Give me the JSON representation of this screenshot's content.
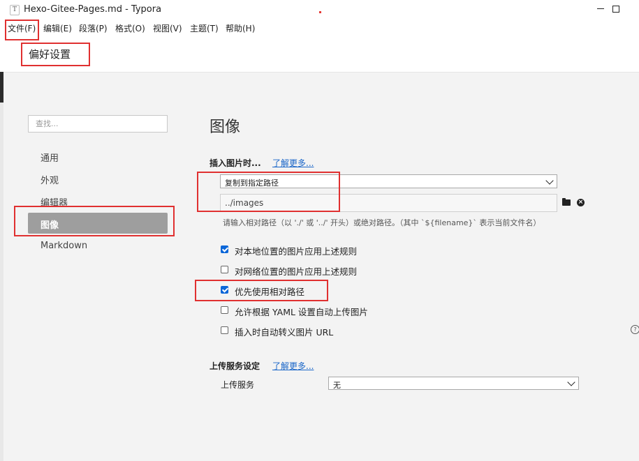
{
  "window": {
    "title": "Hexo-Gitee-Pages.md - Typora",
    "app_icon_letter": "T"
  },
  "menubar": {
    "items": [
      "文件(F)",
      "编辑(E)",
      "段落(P)",
      "格式(O)",
      "视图(V)",
      "主题(T)",
      "帮助(H)"
    ]
  },
  "preferences": {
    "header": "偏好设置",
    "search_placeholder": "查找...",
    "nav": [
      "通用",
      "外观",
      "编辑器",
      "图像",
      "Markdown"
    ],
    "active_nav": "图像"
  },
  "image_section": {
    "title": "图像",
    "insert_label": "插入图片时...",
    "learn_more": "了解更多...",
    "insert_action": "复制到指定路径",
    "path_value": "../images",
    "hint": "请输入相对路径（以 './' 或 '../' 开头）或绝对路径。（其中 `${filename}` 表示当前文件名）",
    "options": [
      {
        "label": "对本地位置的图片应用上述规则",
        "checked": true
      },
      {
        "label": "对网络位置的图片应用上述规则",
        "checked": false
      },
      {
        "label": "优先使用相对路径",
        "checked": true
      },
      {
        "label": "允许根据 YAML 设置自动上传图片",
        "checked": false
      },
      {
        "label": "插入时自动转义图片 URL",
        "checked": false
      }
    ]
  },
  "upload_section": {
    "title": "上传服务设定",
    "learn_more": "了解更多...",
    "service_label": "上传服务",
    "service_value": "无"
  },
  "icons": {
    "folder": "folder-icon",
    "clear": "clear-icon",
    "help": "help-icon"
  },
  "annotation_color": "#e03030",
  "accent_color": "#0a66d8"
}
